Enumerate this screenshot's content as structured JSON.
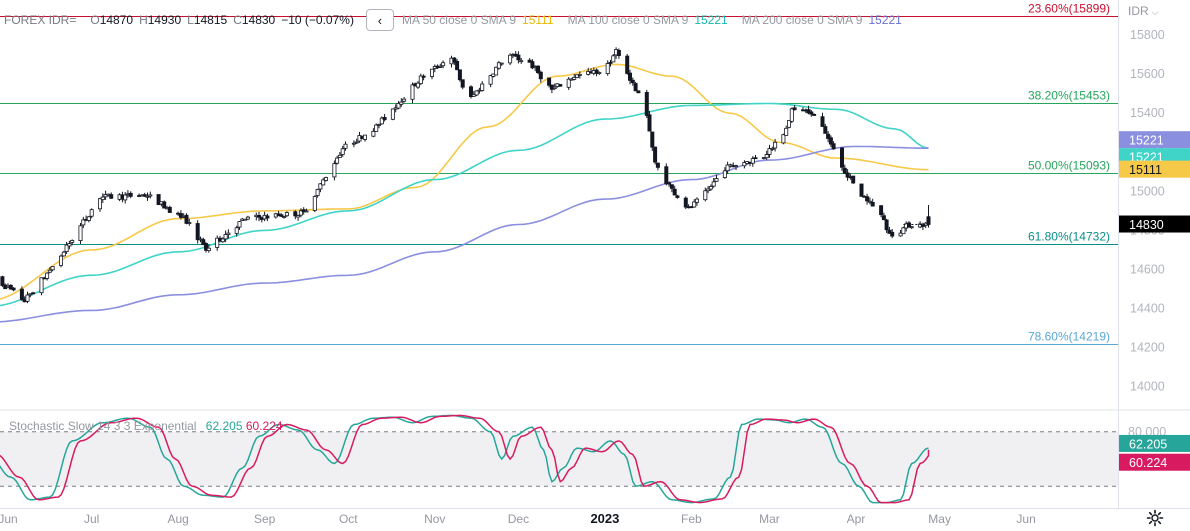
{
  "header": {
    "symbol": "FOREX IDR=",
    "open_label": "O",
    "open": "14870",
    "high_label": "H",
    "high": "14930",
    "low_label": "L",
    "low": "14815",
    "close_label": "C",
    "close": "14830",
    "change": "−10 (−0.07%)",
    "collapse_icon": "chevron-left-icon",
    "ma50_title": "MA 50 close 0 SMA 9",
    "ma50_value": "15111",
    "ma100_title": "MA 100 close 0 SMA 9",
    "ma100_value": "15221",
    "ma200_title": "MA 200 close 0 SMA 9",
    "ma200_value": "15221"
  },
  "currency_menu": {
    "label": "IDR",
    "icon": "chevron-down-icon"
  },
  "stoch_legend": {
    "title": "Stochastic Slow 14 3 3 Exponential",
    "k_value": "62.205",
    "d_value": "60.224"
  },
  "settings_icon": "gear-icon",
  "colors": {
    "up": "#131722",
    "down": "#131722",
    "ma50": "#f7c948",
    "ma100": "#40d4c8",
    "ma200": "#8b8fe0",
    "fib_red": "#c8102e",
    "fib_green": "#26a65b",
    "fib_teal": "#0a8f86",
    "fib_blue": "#5aa8d6",
    "stoch_k": "#26a69a",
    "stoch_d": "#d81b60",
    "price_tag": "#000000"
  },
  "chart_data": [
    {
      "type": "candlestick",
      "title": "FOREX IDR=",
      "y_range": [
        13880,
        15980
      ],
      "y_ticks": [
        14000,
        14200,
        14400,
        14600,
        14800,
        15000,
        15200,
        15400,
        15600,
        15800
      ],
      "x_range": [
        "2022-06-01",
        "2023-06-30"
      ],
      "x_ticks": [
        {
          "date": "2022-06-01",
          "label": "Jun"
        },
        {
          "date": "2022-07-01",
          "label": "Jul"
        },
        {
          "date": "2022-08-01",
          "label": "Aug"
        },
        {
          "date": "2022-09-01",
          "label": "Sep"
        },
        {
          "date": "2022-10-01",
          "label": "Oct"
        },
        {
          "date": "2022-11-01",
          "label": "Nov"
        },
        {
          "date": "2022-12-01",
          "label": "Dec"
        },
        {
          "date": "2023-01-01",
          "label": "2023"
        },
        {
          "date": "2023-02-01",
          "label": "Feb"
        },
        {
          "date": "2023-03-01",
          "label": "Mar"
        },
        {
          "date": "2023-04-01",
          "label": "Apr"
        },
        {
          "date": "2023-05-01",
          "label": "May"
        },
        {
          "date": "2023-06-01",
          "label": "Jun"
        }
      ],
      "price_anchors": [
        [
          "2022-05-25",
          14590
        ],
        [
          "2022-06-08",
          14440
        ],
        [
          "2022-06-20",
          14650
        ],
        [
          "2022-07-05",
          14970
        ],
        [
          "2022-07-22",
          14980
        ],
        [
          "2022-08-05",
          14850
        ],
        [
          "2022-08-12",
          14700
        ],
        [
          "2022-08-26",
          14860
        ],
        [
          "2022-09-16",
          14890
        ],
        [
          "2022-09-30",
          15220
        ],
        [
          "2022-10-12",
          15330
        ],
        [
          "2022-10-28",
          15580
        ],
        [
          "2022-11-08",
          15690
        ],
        [
          "2022-11-14",
          15460
        ],
        [
          "2022-11-28",
          15700
        ],
        [
          "2022-12-06",
          15660
        ],
        [
          "2022-12-14",
          15520
        ],
        [
          "2022-12-22",
          15590
        ],
        [
          "2023-01-02",
          15620
        ],
        [
          "2023-01-06",
          15720
        ],
        [
          "2023-01-12",
          15550
        ],
        [
          "2023-01-17",
          15400
        ],
        [
          "2023-01-20",
          15140
        ],
        [
          "2023-01-26",
          15010
        ],
        [
          "2023-02-01",
          14910
        ],
        [
          "2023-02-06",
          14970
        ],
        [
          "2023-02-14",
          15120
        ],
        [
          "2023-02-28",
          15180
        ],
        [
          "2023-03-07",
          15300
        ],
        [
          "2023-03-10",
          15410
        ],
        [
          "2023-03-14",
          15420
        ],
        [
          "2023-03-20",
          15360
        ],
        [
          "2023-03-27",
          15150
        ],
        [
          "2023-04-03",
          14990
        ],
        [
          "2023-04-10",
          14910
        ],
        [
          "2023-04-14",
          14780
        ],
        [
          "2023-04-18",
          14800
        ],
        [
          "2023-04-21",
          14830
        ],
        [
          "2023-04-27",
          14830
        ]
      ],
      "last_candle": {
        "date": "2023-04-27",
        "open": 14870,
        "high": 14930,
        "low": 14815,
        "close": 14830
      },
      "moving_averages": [
        {
          "name": "MA 50",
          "color_key": "ma50",
          "value_label": "15111",
          "tag_price": 15111,
          "points": [
            [
              "2022-05-25",
              14440
            ],
            [
              "2022-07-01",
              14700
            ],
            [
              "2022-08-01",
              14860
            ],
            [
              "2022-09-01",
              14900
            ],
            [
              "2022-10-01",
              14910
            ],
            [
              "2022-10-25",
              15020
            ],
            [
              "2022-11-20",
              15330
            ],
            [
              "2022-12-15",
              15590
            ],
            [
              "2023-01-05",
              15650
            ],
            [
              "2023-01-25",
              15590
            ],
            [
              "2023-02-15",
              15400
            ],
            [
              "2023-03-05",
              15250
            ],
            [
              "2023-03-25",
              15170
            ],
            [
              "2023-04-27",
              15111
            ]
          ]
        },
        {
          "name": "MA 100",
          "color_key": "ma100",
          "value_label": "15221",
          "tag_price": 15221,
          "points": [
            [
              "2022-05-25",
              14410
            ],
            [
              "2022-07-01",
              14570
            ],
            [
              "2022-08-01",
              14690
            ],
            [
              "2022-09-01",
              14800
            ],
            [
              "2022-10-01",
              14900
            ],
            [
              "2022-11-01",
              15060
            ],
            [
              "2022-12-01",
              15210
            ],
            [
              "2023-01-01",
              15370
            ],
            [
              "2023-02-01",
              15440
            ],
            [
              "2023-03-01",
              15450
            ],
            [
              "2023-03-25",
              15420
            ],
            [
              "2023-04-15",
              15320
            ],
            [
              "2023-04-27",
              15221
            ]
          ]
        },
        {
          "name": "MA 200",
          "color_key": "ma200",
          "value_label": "15221",
          "tag_price": 15221,
          "points": [
            [
              "2022-05-25",
              14330
            ],
            [
              "2022-07-01",
              14390
            ],
            [
              "2022-08-01",
              14470
            ],
            [
              "2022-09-01",
              14530
            ],
            [
              "2022-10-01",
              14570
            ],
            [
              "2022-11-01",
              14690
            ],
            [
              "2022-12-01",
              14830
            ],
            [
              "2023-01-01",
              14960
            ],
            [
              "2023-02-01",
              15060
            ],
            [
              "2023-03-01",
              15160
            ],
            [
              "2023-04-01",
              15230
            ],
            [
              "2023-04-27",
              15221
            ]
          ]
        }
      ],
      "fib_levels": [
        {
          "label": "23.60%(15899)",
          "price": 15899,
          "color_key": "fib_red"
        },
        {
          "label": "38.20%(15453)",
          "price": 15453,
          "color_key": "fib_green"
        },
        {
          "label": "50.00%(15093)",
          "price": 15093,
          "color_key": "fib_green"
        },
        {
          "label": "61.80%(14732)",
          "price": 14732,
          "color_key": "fib_teal"
        },
        {
          "label": "78.60%(14219)",
          "price": 14219,
          "color_key": "fib_blue"
        }
      ],
      "price_tags": [
        {
          "label": "15221",
          "price": 15221,
          "color_key": "ma200",
          "offset": -8
        },
        {
          "label": "15221",
          "price": 15221,
          "color_key": "ma100",
          "offset": 9
        },
        {
          "label": "15111",
          "price": 15111,
          "color_key": "ma50",
          "offset": 0
        },
        {
          "label": "14830",
          "price": 14830,
          "color_key": "price_tag",
          "offset": 0
        }
      ]
    },
    {
      "type": "line",
      "title": "Stochastic Slow 14 3 3 Exponential",
      "y_range": [
        -4,
        104
      ],
      "y_ticks": [
        {
          "value": 80,
          "label": "80.000"
        }
      ],
      "bands": [
        20,
        80
      ],
      "series": [
        {
          "name": "%K",
          "color_key": "stoch_k",
          "value_label": "62.205",
          "last": 62.205
        },
        {
          "name": "%D",
          "color_key": "stoch_d",
          "value_label": "60.224",
          "last": 60.224
        }
      ],
      "k_anchors": [
        [
          "2022-05-25",
          55
        ],
        [
          "2022-06-02",
          30
        ],
        [
          "2022-06-09",
          5
        ],
        [
          "2022-06-16",
          8
        ],
        [
          "2022-06-24",
          70
        ],
        [
          "2022-07-05",
          90
        ],
        [
          "2022-07-14",
          95
        ],
        [
          "2022-07-22",
          85
        ],
        [
          "2022-07-28",
          50
        ],
        [
          "2022-08-03",
          20
        ],
        [
          "2022-08-10",
          10
        ],
        [
          "2022-08-17",
          8
        ],
        [
          "2022-08-24",
          40
        ],
        [
          "2022-08-30",
          75
        ],
        [
          "2022-09-06",
          88
        ],
        [
          "2022-09-13",
          82
        ],
        [
          "2022-09-20",
          60
        ],
        [
          "2022-09-26",
          45
        ],
        [
          "2022-10-03",
          88
        ],
        [
          "2022-10-10",
          95
        ],
        [
          "2022-10-17",
          96
        ],
        [
          "2022-10-24",
          90
        ],
        [
          "2022-10-31",
          97
        ],
        [
          "2022-11-07",
          98
        ],
        [
          "2022-11-14",
          95
        ],
        [
          "2022-11-21",
          80
        ],
        [
          "2022-11-25",
          50
        ],
        [
          "2022-11-29",
          75
        ],
        [
          "2022-12-06",
          85
        ],
        [
          "2022-12-10",
          60
        ],
        [
          "2022-12-13",
          25
        ],
        [
          "2022-12-17",
          40
        ],
        [
          "2022-12-22",
          62
        ],
        [
          "2022-12-28",
          58
        ],
        [
          "2023-01-03",
          70
        ],
        [
          "2023-01-08",
          55
        ],
        [
          "2023-01-12",
          20
        ],
        [
          "2023-01-18",
          25
        ],
        [
          "2023-01-25",
          5
        ],
        [
          "2023-02-01",
          2
        ],
        [
          "2023-02-09",
          6
        ],
        [
          "2023-02-15",
          30
        ],
        [
          "2023-02-19",
          88
        ],
        [
          "2023-02-25",
          94
        ],
        [
          "2023-03-03",
          93
        ],
        [
          "2023-03-08",
          90
        ],
        [
          "2023-03-14",
          94
        ],
        [
          "2023-03-20",
          85
        ],
        [
          "2023-03-27",
          45
        ],
        [
          "2023-04-02",
          20
        ],
        [
          "2023-04-07",
          2
        ],
        [
          "2023-04-12",
          2
        ],
        [
          "2023-04-17",
          5
        ],
        [
          "2023-04-21",
          45
        ],
        [
          "2023-04-27",
          62.205
        ]
      ],
      "d_lag_days": 3
    }
  ]
}
